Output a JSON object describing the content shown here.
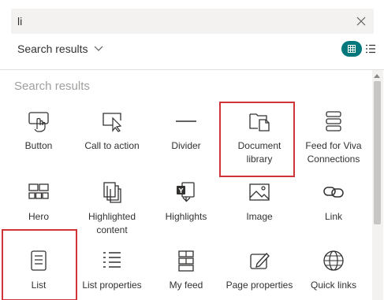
{
  "search": {
    "value": "li",
    "clear_icon": "close-icon"
  },
  "results_filter": {
    "label": "Search results"
  },
  "view_toggle": {
    "grid_icon": "grid-view-icon",
    "list_icon": "list-view-icon",
    "accent": "#03787c"
  },
  "panel": {
    "heading": "Search results"
  },
  "tiles": [
    {
      "label": "Button",
      "icon": "button-icon"
    },
    {
      "label": "Call to action",
      "icon": "call-to-action-icon"
    },
    {
      "label": "Divider",
      "icon": "divider-icon"
    },
    {
      "label": "Document library",
      "icon": "document-library-icon",
      "highlighted": true
    },
    {
      "label": "Feed for Viva Connections",
      "icon": "feed-icon"
    },
    {
      "label": "Hero",
      "icon": "hero-icon"
    },
    {
      "label": "Highlighted content",
      "icon": "highlighted-content-icon"
    },
    {
      "label": "Highlights",
      "icon": "highlights-icon"
    },
    {
      "label": "Image",
      "icon": "image-icon"
    },
    {
      "label": "Link",
      "icon": "link-icon"
    },
    {
      "label": "List",
      "icon": "list-icon",
      "highlighted": true
    },
    {
      "label": "List properties",
      "icon": "list-properties-icon"
    },
    {
      "label": "My feed",
      "icon": "my-feed-icon"
    },
    {
      "label": "Page properties",
      "icon": "page-properties-icon"
    },
    {
      "label": "Quick links",
      "icon": "quick-links-icon"
    }
  ],
  "highlight_color": "#d13438"
}
